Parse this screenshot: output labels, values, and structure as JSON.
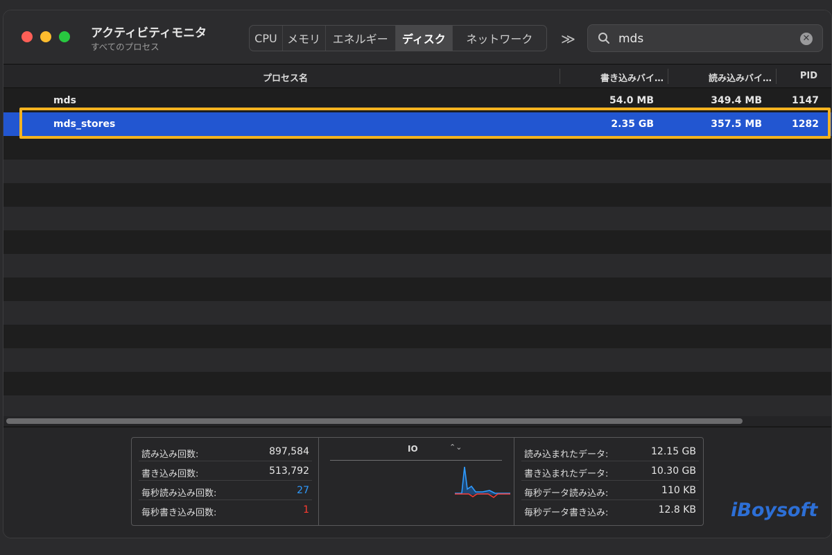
{
  "app": {
    "title": "アクティビティモニタ",
    "subtitle": "すべてのプロセス"
  },
  "tabs": [
    {
      "label": "CPU",
      "active": false
    },
    {
      "label": "メモリ",
      "active": false
    },
    {
      "label": "エネルギー",
      "active": false
    },
    {
      "label": "ディスク",
      "active": true
    },
    {
      "label": "ネットワーク",
      "active": false
    }
  ],
  "toolbar": {
    "more_icon": "chevron-double-right-icon",
    "more_label": "≫"
  },
  "search": {
    "value": "mds",
    "clear_label": "✕"
  },
  "columns": {
    "name": "プロセス名",
    "write": "書き込みバイ…",
    "read": "読み込みバイ…",
    "pid": "PID"
  },
  "rows": [
    {
      "name": "mds",
      "write": "54.0 MB",
      "read": "349.4 MB",
      "pid": "1147",
      "selected": false
    },
    {
      "name": "mds_stores",
      "write": "2.35 GB",
      "read": "357.5 MB",
      "pid": "1282",
      "selected": true
    }
  ],
  "stats_left": [
    {
      "label": "読み込み回数:",
      "value": "897,584"
    },
    {
      "label": "書き込み回数:",
      "value": "513,792"
    },
    {
      "label": "毎秒読み込み回数:",
      "value": "27"
    },
    {
      "label": "毎秒書き込み回数:",
      "value": "1"
    }
  ],
  "graph": {
    "label": "IO",
    "selector_glyph": "⌃⌄"
  },
  "stats_right": [
    {
      "label": "読み込まれたデータ:",
      "value": "12.15 GB"
    },
    {
      "label": "書き込まれたデータ:",
      "value": "10.30 GB"
    },
    {
      "label": "毎秒データ読み込み:",
      "value": "110 KB"
    },
    {
      "label": "毎秒データ書き込み:",
      "value": "12.8 KB"
    }
  ],
  "colors": {
    "selected_row": "#2256d1",
    "highlight": "#f4b320",
    "read_series": "#2f9bff",
    "write_series": "#ff3b30"
  },
  "brand": "iBoysoft"
}
